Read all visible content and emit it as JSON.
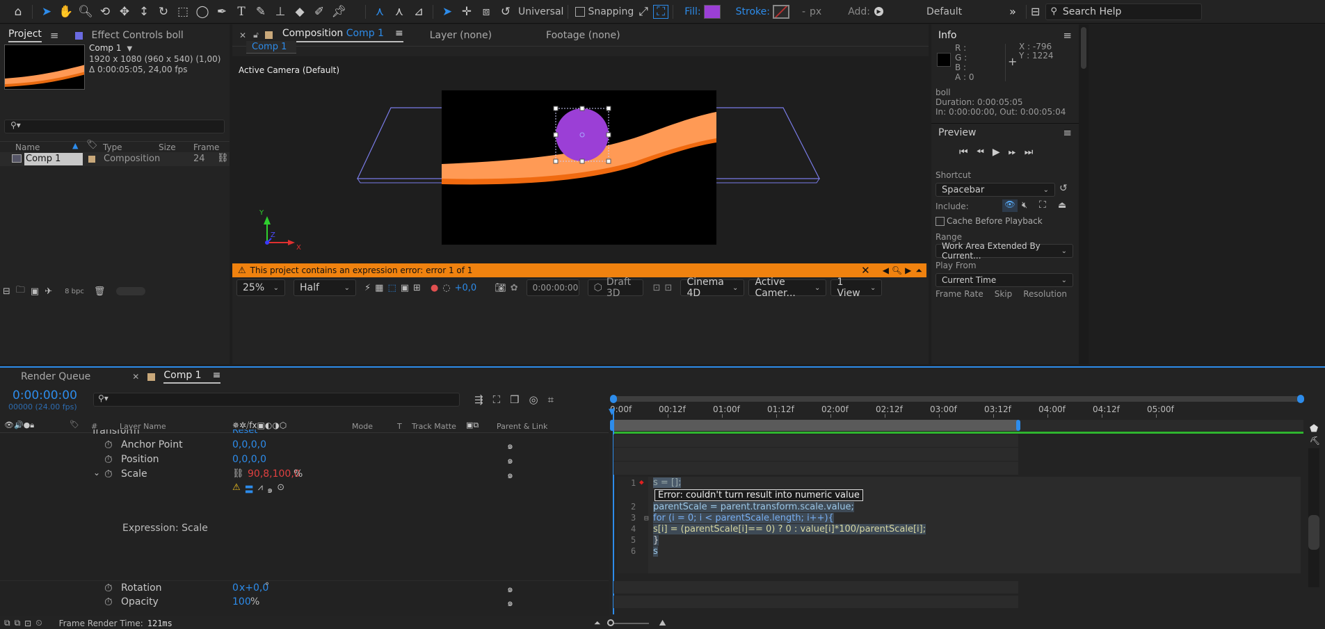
{
  "toolbar": {
    "universal": "Universal",
    "snapping": "Snapping",
    "fill": "Fill:",
    "stroke": "Stroke:",
    "px_dash": "-",
    "px": "px",
    "add": "Add:",
    "workspace": "Default",
    "search_placeholder": "Search Help",
    "fill_color": "#9b3fd6"
  },
  "project": {
    "tab_project": "Project",
    "tab_effect": "Effect Controls boll",
    "comp_name": "Comp 1",
    "comp_res": "1920 x 1080  (960 x 540) (1,00)",
    "comp_dur": "Δ 0:00:05:05, 24,00 fps",
    "col_name": "Name",
    "col_type": "Type",
    "col_size": "Size",
    "col_frame": "Frame R...",
    "row_name": "Comp 1",
    "row_type": "Composition",
    "row_frame": "24",
    "bpc": "8 bpc"
  },
  "viewer": {
    "tab_comp": "Composition",
    "tab_comp_name": "Comp 1",
    "tab_layer": "Layer  (none)",
    "tab_footage": "Footage  (none)",
    "sub_tab": "Comp 1",
    "camera_label": "Active Camera (Default)",
    "axis_y": "Y",
    "axis_z": "Z",
    "axis_x": "X",
    "error_msg": "This project contains an expression error: error 1 of 1",
    "zoom": "25%",
    "quality": "Half",
    "exposure": "+0,0",
    "timecode": "0:00:00:00",
    "draft3d": "Draft 3D",
    "renderer": "Cinema 4D",
    "camera": "Active Camer...",
    "views": "1 View"
  },
  "info": {
    "title": "Info",
    "r": "R :",
    "g": "G :",
    "b": "B :",
    "a": "A :  0",
    "x": "X : -796",
    "y": "Y :  1224",
    "layer": "boll",
    "duration": "Duration: 0:00:05:05",
    "inout": "In: 0:00:00:00, Out: 0:00:05:04"
  },
  "preview": {
    "title": "Preview",
    "shortcut_label": "Shortcut",
    "shortcut_value": "Spacebar",
    "include_label": "Include:",
    "cache_label": "Cache Before Playback",
    "range_label": "Range",
    "range_value": "Work Area Extended By Current...",
    "playfrom_label": "Play From",
    "playfrom_value": "Current Time",
    "framerate": "Frame Rate",
    "skip": "Skip",
    "resolution": "Resolution"
  },
  "timeline": {
    "tab_render": "Render Queue",
    "tab_comp": "Comp 1",
    "timecode": "0:00:00:00",
    "fps": "00000 (24.00 fps)",
    "col_hash": "#",
    "col_layername": "Layer Name",
    "col_mode": "Mode",
    "col_t": "T",
    "col_trackmatte": "Track Matte",
    "col_parent": "Parent & Link",
    "transform_partial": "Transform",
    "reset_partial": "Reset",
    "props": [
      {
        "name": "Anchor Point",
        "value": "0,0,0,0"
      },
      {
        "name": "Position",
        "value": "0,0,0,0"
      },
      {
        "name": "Scale",
        "value": "90,8,100,0",
        "unit": "%"
      },
      {
        "name": "Rotation",
        "value": "0",
        "value2": "x+0,0",
        "unit": "°"
      },
      {
        "name": "Opacity",
        "value": "100",
        "unit": "%"
      }
    ],
    "expression_label": "Expression: Scale",
    "ruler": [
      "0:00f",
      "00:12f",
      "01:00f",
      "01:12f",
      "02:00f",
      "02:12f",
      "03:00f",
      "03:12f",
      "04:00f",
      "04:12f",
      "05:00f"
    ],
    "code_lines": [
      {
        "num": "1",
        "text": "s = [];"
      },
      {
        "num": "2",
        "text": "parentScale = parent.transform.scale.value;"
      },
      {
        "num": "3",
        "text": "for (i = 0; i < parentScale.length; i++){"
      },
      {
        "num": "4",
        "text": "s[i] = (parentScale[i]== 0) ? 0 : value[i]*100/parentScale[i];"
      },
      {
        "num": "5",
        "text": "}"
      },
      {
        "num": "6",
        "text": "s"
      }
    ],
    "error_tooltip": "Error:  couldn't turn result into numeric value",
    "render_time_label": "Frame Render Time:",
    "render_time_value": "121ms"
  }
}
